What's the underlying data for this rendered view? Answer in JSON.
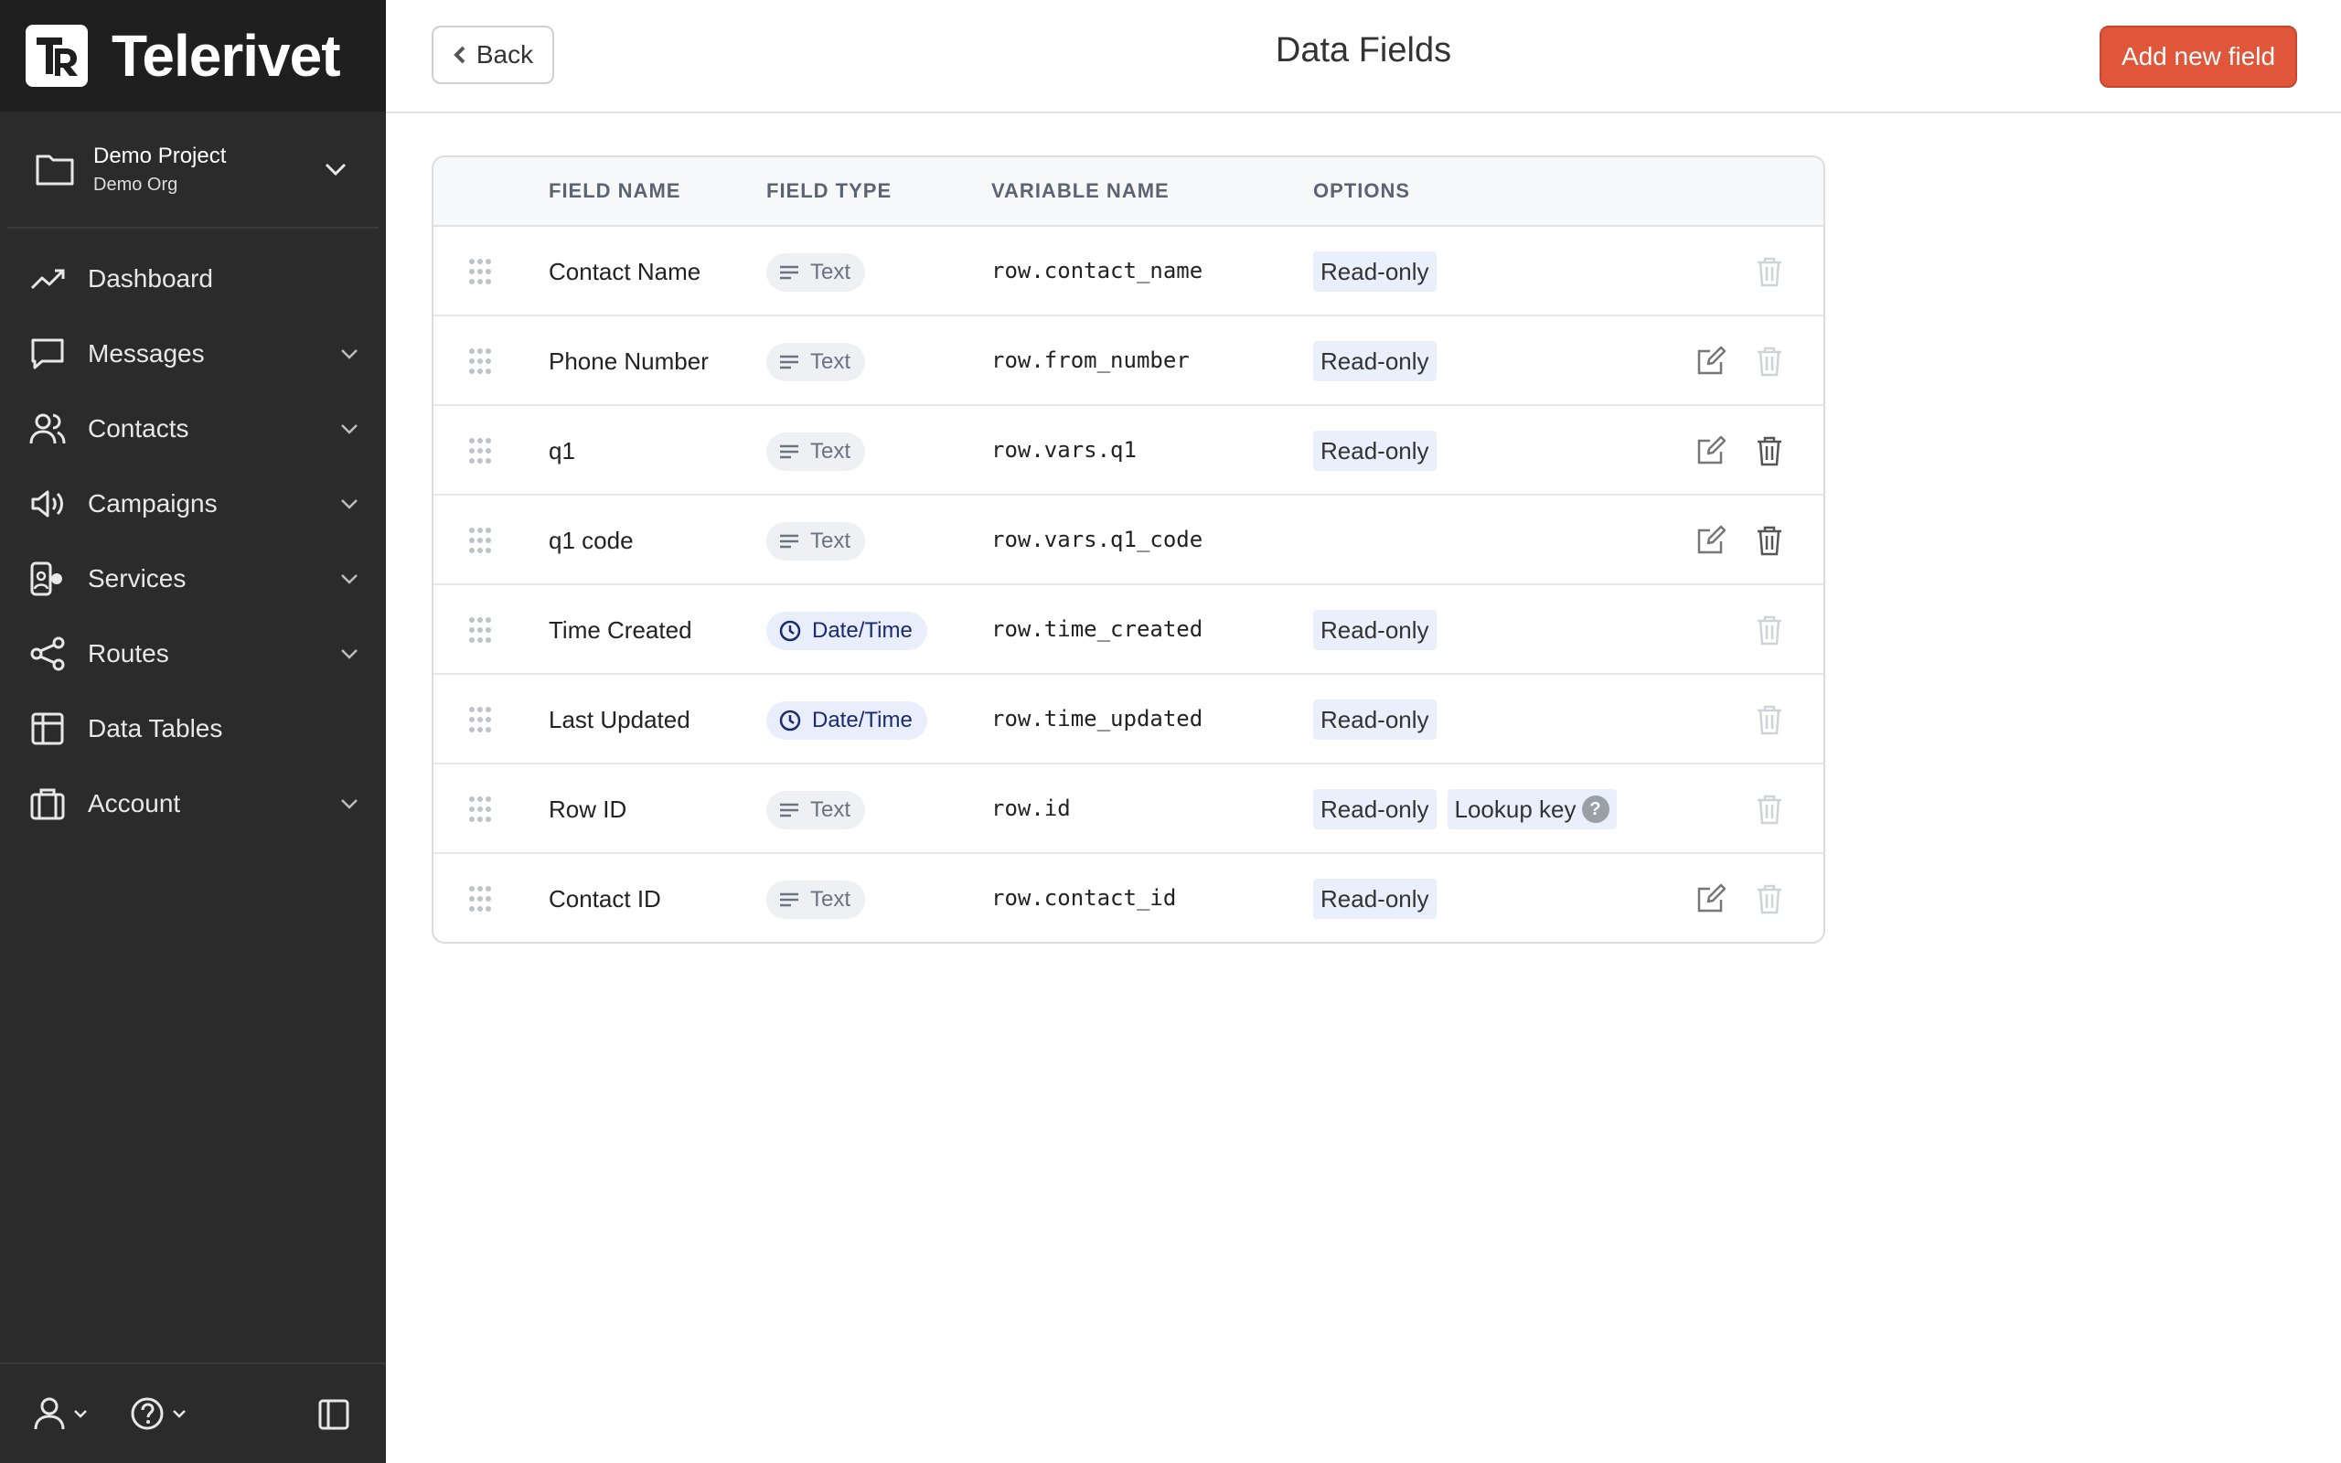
{
  "brand": {
    "name": "Telerivet"
  },
  "project": {
    "name": "Demo Project",
    "org": "Demo Org"
  },
  "nav": {
    "items": [
      {
        "label": "Dashboard",
        "icon": "trending-up-icon",
        "chevron": false
      },
      {
        "label": "Messages",
        "icon": "message-icon",
        "chevron": true
      },
      {
        "label": "Contacts",
        "icon": "users-icon",
        "chevron": true
      },
      {
        "label": "Campaigns",
        "icon": "megaphone-icon",
        "chevron": true
      },
      {
        "label": "Services",
        "icon": "services-icon",
        "chevron": true
      },
      {
        "label": "Routes",
        "icon": "share-icon",
        "chevron": true
      },
      {
        "label": "Data Tables",
        "icon": "table-icon",
        "chevron": false
      },
      {
        "label": "Account",
        "icon": "briefcase-icon",
        "chevron": true
      }
    ]
  },
  "header": {
    "back_label": "Back",
    "title": "Data Fields",
    "add_label": "Add new field"
  },
  "table": {
    "columns": {
      "field_name": "FIELD NAME",
      "field_type": "FIELD TYPE",
      "variable_name": "VARIABLE NAME",
      "options": "OPTIONS"
    },
    "rows": [
      {
        "name": "Contact Name",
        "type": "Text",
        "kind": "text",
        "variable": "row.contact_name",
        "options": [
          "Read-only"
        ],
        "help": false,
        "editable": false,
        "deletable": false
      },
      {
        "name": "Phone Number",
        "type": "Text",
        "kind": "text",
        "variable": "row.from_number",
        "options": [
          "Read-only"
        ],
        "help": false,
        "editable": true,
        "deletable": false
      },
      {
        "name": "q1",
        "type": "Text",
        "kind": "text",
        "variable": "row.vars.q1",
        "options": [
          "Read-only"
        ],
        "help": false,
        "editable": true,
        "deletable": true
      },
      {
        "name": "q1 code",
        "type": "Text",
        "kind": "text",
        "variable": "row.vars.q1_code",
        "options": [],
        "help": false,
        "editable": true,
        "deletable": true
      },
      {
        "name": "Time Created",
        "type": "Date/Time",
        "kind": "datetime",
        "variable": "row.time_created",
        "options": [
          "Read-only"
        ],
        "help": false,
        "editable": false,
        "deletable": false
      },
      {
        "name": "Last Updated",
        "type": "Date/Time",
        "kind": "datetime",
        "variable": "row.time_updated",
        "options": [
          "Read-only"
        ],
        "help": false,
        "editable": false,
        "deletable": false
      },
      {
        "name": "Row ID",
        "type": "Text",
        "kind": "text",
        "variable": "row.id",
        "options": [
          "Read-only",
          "Lookup key"
        ],
        "help": true,
        "editable": false,
        "deletable": false
      },
      {
        "name": "Contact ID",
        "type": "Text",
        "kind": "text",
        "variable": "row.contact_id",
        "options": [
          "Read-only"
        ],
        "help": false,
        "editable": true,
        "deletable": false
      }
    ]
  },
  "help_glyph": "?",
  "colors": {
    "sidebar": "#2b2b2b",
    "accent": "#e0563a",
    "tag": "#e9effb",
    "datetime": "#1b2a73"
  }
}
